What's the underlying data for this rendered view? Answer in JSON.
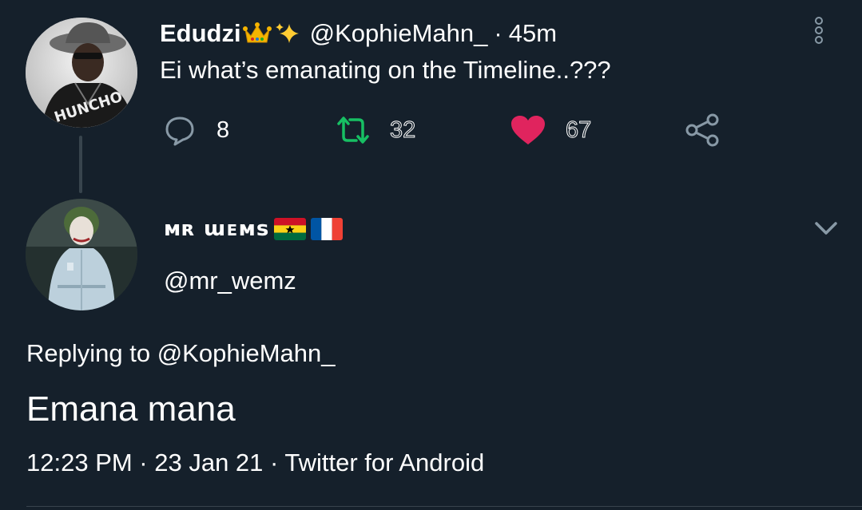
{
  "parent_tweet": {
    "display_name": "Edudzi",
    "name_emojis": [
      "crown-emoji",
      "sparkles-emoji"
    ],
    "handle": "@KophieMahn_",
    "separator": "·",
    "time": "45m",
    "text": "Ei what’s emanating on the Timeline..???",
    "actions": {
      "replies": "8",
      "retweets": "32",
      "likes": "67"
    },
    "colors": {
      "retweet": "#17bf63",
      "like": "#e0245e",
      "icon": "#8899a6"
    }
  },
  "reply_tweet": {
    "display_name": "ᴍʀ ɯᴇᴍѕ",
    "flags": [
      "ghana-flag",
      "france-flag"
    ],
    "handle": "@mr_wemz",
    "replying_to": "Replying to @KophieMahn_",
    "text": "Emana mana",
    "timestamp": "12:23 PM · 23 Jan 21 · Twitter for Android"
  },
  "theme": {
    "background": "#15202b",
    "divider": "#38444d"
  }
}
